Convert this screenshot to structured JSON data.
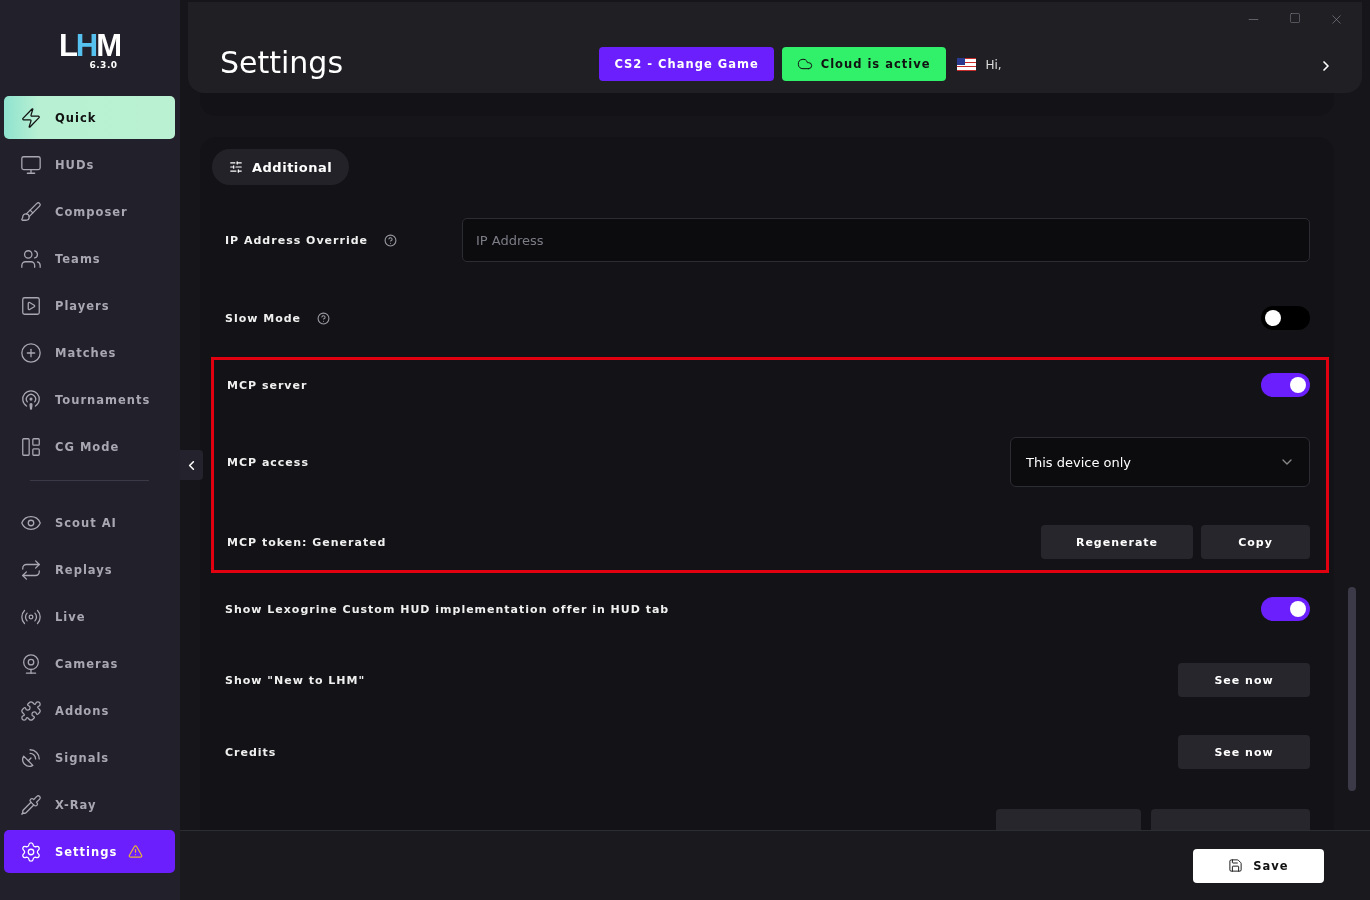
{
  "sidebar": {
    "logo": "LHM",
    "version": "6.3.0",
    "sections": [
      [
        {
          "label": "Quick",
          "kind": "quick",
          "selected": false
        },
        {
          "label": "HUDs",
          "kind": "link",
          "selected": false
        },
        {
          "label": "Composer",
          "kind": "link",
          "selected": false
        },
        {
          "label": "Teams",
          "kind": "link",
          "selected": false
        },
        {
          "label": "Players",
          "kind": "link",
          "selected": false
        },
        {
          "label": "Matches",
          "kind": "link",
          "selected": false
        },
        {
          "label": "Tournaments",
          "kind": "link",
          "selected": false
        },
        {
          "label": "CG Mode",
          "kind": "link",
          "selected": false
        }
      ],
      [
        {
          "label": "Scout AI",
          "kind": "link",
          "selected": false
        },
        {
          "label": "Replays",
          "kind": "link",
          "selected": false
        },
        {
          "label": "Live",
          "kind": "link",
          "selected": false
        },
        {
          "label": "Cameras",
          "kind": "link",
          "selected": false
        },
        {
          "label": "Addons",
          "kind": "link",
          "selected": false
        },
        {
          "label": "Signals",
          "kind": "link",
          "selected": false
        },
        {
          "label": "X-Ray",
          "kind": "link",
          "selected": false
        },
        {
          "label": "Settings",
          "kind": "link",
          "selected": true,
          "warning": true
        }
      ]
    ]
  },
  "header": {
    "title": "Settings",
    "game_button": "CS2 - Change Game",
    "cloud_button": "Cloud is active",
    "greeting": "Hi,"
  },
  "section": {
    "title": "Additional",
    "rows": [
      {
        "kind": "input",
        "label": "IP Address Override",
        "help": true,
        "placeholder": "IP Address"
      },
      {
        "kind": "toggle",
        "label": "Slow Mode",
        "help": true,
        "on": false
      },
      {
        "kind": "group",
        "rows": [
          {
            "kind": "toggle",
            "label": "MCP server",
            "on": true
          },
          {
            "kind": "select",
            "label": "MCP access",
            "value": "This device only"
          },
          {
            "kind": "buttons",
            "label": "MCP token: Generated",
            "buttons": [
              "Regenerate",
              "Copy"
            ]
          }
        ]
      },
      {
        "kind": "toggle",
        "label": "Show Lexogrine Custom HUD implementation offer in HUD tab",
        "on": true
      },
      {
        "kind": "buttons",
        "label": "Show \"New to LHM\"",
        "buttons": [
          "See now"
        ]
      },
      {
        "kind": "buttons",
        "label": "Credits",
        "buttons": [
          "See now"
        ]
      },
      {
        "kind": "cut"
      }
    ]
  },
  "footer": {
    "save_button": "Save"
  }
}
